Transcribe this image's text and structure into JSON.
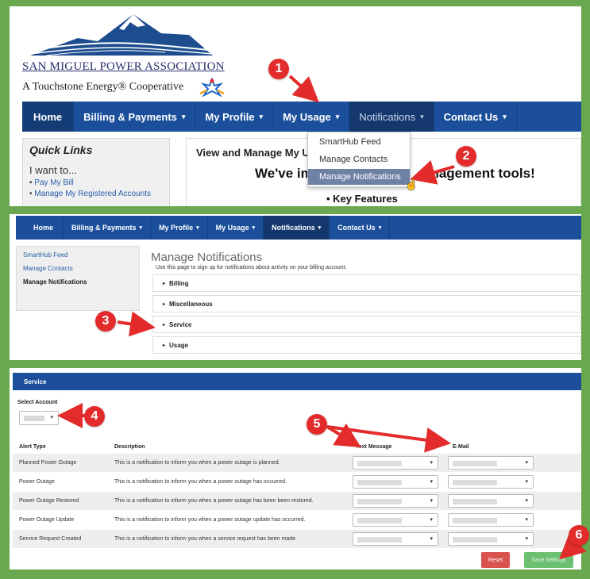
{
  "colors": {
    "nav": "#1b4f9c",
    "frame": "#6aa84f",
    "annotation": "#e32b2b",
    "reset": "#d9534f",
    "save": "#6cc070"
  },
  "logo": {
    "name": "SAN MIGUEL POWER ASSOCIATION",
    "tagline": "A Touchstone Energy® Cooperative"
  },
  "nav1": {
    "items": [
      {
        "label": "Home"
      },
      {
        "label": "Billing & Payments"
      },
      {
        "label": "My Profile"
      },
      {
        "label": "My Usage"
      },
      {
        "label": "Notifications"
      },
      {
        "label": "Contact Us"
      }
    ],
    "caret": "▾"
  },
  "quick_links": {
    "title": "Quick Links",
    "subtitle": "I want to...",
    "items": [
      "Pay My Bill",
      "Manage My Registered Accounts"
    ]
  },
  "main_box": {
    "title": "View and Manage My Usa",
    "headline_left": "We've imp",
    "headline_right": "anagement tools!",
    "key_features": "Key Features"
  },
  "notifications_menu": {
    "items": [
      "SmartHub Feed",
      "Manage Contacts",
      "Manage Notifications"
    ]
  },
  "nav2": {
    "items": [
      {
        "label": "Home"
      },
      {
        "label": "Billing & Payments"
      },
      {
        "label": "My Profile"
      },
      {
        "label": "My Usage"
      },
      {
        "label": "Notifications"
      },
      {
        "label": "Contact Us"
      }
    ]
  },
  "sidebar2": {
    "items": [
      "SmartHub Feed",
      "Manage Contacts",
      "Manage Notifications"
    ]
  },
  "manage_notifications": {
    "title": "Manage Notifications",
    "description": "Use this page to sign up for notifications about activity on your billing account.",
    "sections": [
      "Billing",
      "Miscellaneous",
      "Service",
      "Usage"
    ]
  },
  "service": {
    "header": "Service",
    "select_account_label": "Select Account",
    "columns": [
      "Alert Type",
      "Description",
      "Text Message",
      "E-Mail"
    ],
    "rows": [
      {
        "alert": "Planned Power Outage",
        "description": "This is a notification to inform you when a power outage is planned."
      },
      {
        "alert": "Power Outage",
        "description": "This is a notification to inform you when a power outage has occurred."
      },
      {
        "alert": "Power Outage Restored",
        "description": "This is a notification to inform you when a power outage has been been restored."
      },
      {
        "alert": "Power Outage Update",
        "description": "This is a notification to inform you when a power outage update has occurred."
      },
      {
        "alert": "Service Request Created",
        "description": "This is a notification to inform you when a service request has been made."
      }
    ],
    "reset_label": "Reset",
    "save_label": "Save Settings"
  },
  "annotations": [
    "1",
    "2",
    "3",
    "4",
    "5",
    "6"
  ],
  "icons": {
    "dropdown_arrow": "▾",
    "collapsed": "▸",
    "cursor": "☝"
  }
}
